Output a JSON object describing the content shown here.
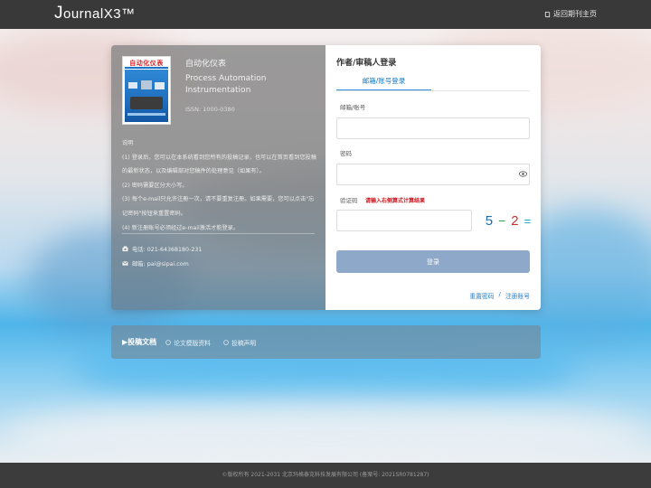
{
  "header": {
    "logo_prefix": "J",
    "logo_text": "ournalX3™",
    "back_home": "返回期刊主页"
  },
  "journal": {
    "name_cn": "自动化仪表",
    "name_en": "Process Automation Instrumentation",
    "issn": "ISSN: 1000-0380",
    "cover_title": "自动化仪表"
  },
  "notes": {
    "title": "说明",
    "items": [
      "(1) 登录后，您可以在本系统看到您所有的投稿记录，也可以在首页看到您投稿的最新状态，以及编辑部对您稿件的处理意见（如果有）。",
      "(2) 密码需要区分大小写。",
      "(3) 每个e-mail只允许注册一次，请不要重复注册。如果需要，您可以点击\"忘记密码\"按钮来重置密码。",
      "(4) 新注册账号必须经过e-mail激活才能登录。"
    ]
  },
  "contact": {
    "phone": "电话: 021-64368180-231",
    "email": "邮箱: pai@sipai.com"
  },
  "form": {
    "title": "作者/审稿人登录",
    "tab_label": "邮箱/账号登录",
    "account_label": "邮箱/账号",
    "account_value": "",
    "password_label": "密码",
    "password_value": "",
    "captcha_label": "验证码",
    "captcha_hint": "请输入右侧算式计算结果",
    "captcha_value": "",
    "captcha_chars": [
      "5",
      "−",
      "2",
      "="
    ],
    "login_button": "登录",
    "reset_password": "重置密码",
    "separator": "/",
    "register": "注册账号"
  },
  "docs": {
    "title": "▶投稿文档",
    "links": [
      "论文模版资料",
      "投稿声明"
    ]
  },
  "footer": {
    "text": "©版权所有 2021-2031 北京玛格泰克科技发展有限公司 (备案号: 2021SR0781287)"
  },
  "colors": {
    "topbar": "#393939",
    "accent": "#2a8fd8",
    "login_button": "#8da8c8",
    "hint_red": "#d0121b"
  }
}
